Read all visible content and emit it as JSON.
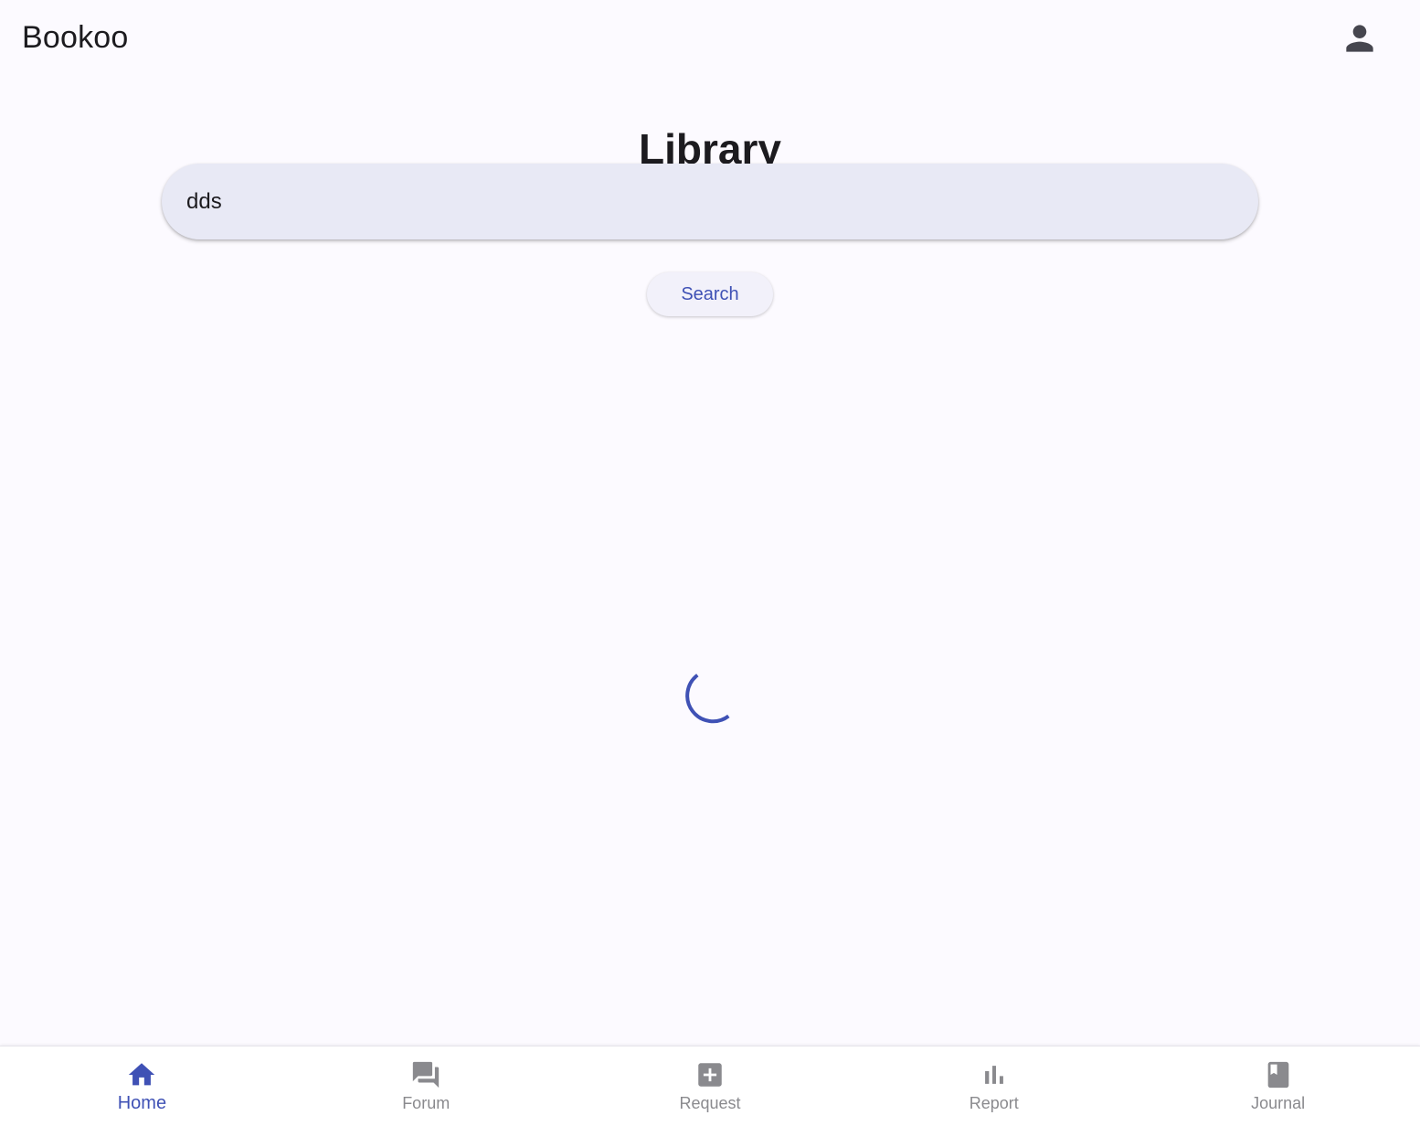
{
  "app": {
    "title": "Bookoo",
    "accent_color": "#3f51b5",
    "inactive_color": "#8a8a8e",
    "account_icon": "person-icon"
  },
  "main": {
    "heading": "Library",
    "search": {
      "value": "dds",
      "placeholder": ""
    },
    "search_button_label": "Search",
    "loading_indicator": "progress-spinner"
  },
  "bottom_nav": {
    "items": [
      {
        "label": "Home",
        "icon": "home-icon",
        "active": true
      },
      {
        "label": "Forum",
        "icon": "forum-icon",
        "active": false
      },
      {
        "label": "Request",
        "icon": "add-box-icon",
        "active": false
      },
      {
        "label": "Report",
        "icon": "bar-chart-icon",
        "active": false
      },
      {
        "label": "Journal",
        "icon": "book-icon",
        "active": false
      }
    ]
  }
}
